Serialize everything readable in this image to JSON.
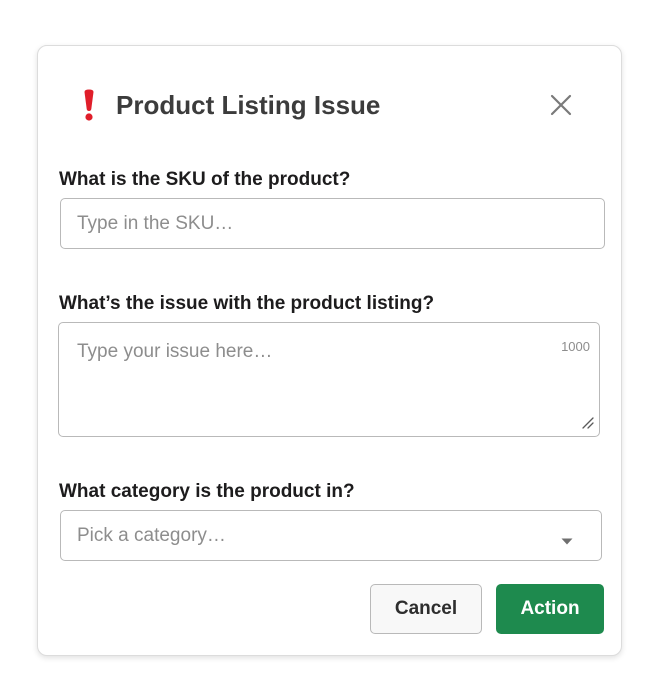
{
  "modal": {
    "title": "Product Listing Issue",
    "title_icon": "exclamation-icon",
    "close_icon": "close-icon"
  },
  "form": {
    "sku": {
      "label": "What is the SKU of the product?",
      "placeholder": "Type in the SKU…",
      "value": ""
    },
    "issue": {
      "label": "What’s the issue with the product listing?",
      "placeholder": "Type your issue here…",
      "value": "",
      "char_count": "1000"
    },
    "category": {
      "label": "What category is the product in?",
      "placeholder": "Pick a category…",
      "caret_icon": "caret-down-icon"
    }
  },
  "buttons": {
    "cancel_label": "Cancel",
    "action_label": "Action"
  },
  "colors": {
    "accent": "#1e8a4e",
    "alert_icon": "#e01e2a",
    "title_text": "#3c3c3c"
  }
}
